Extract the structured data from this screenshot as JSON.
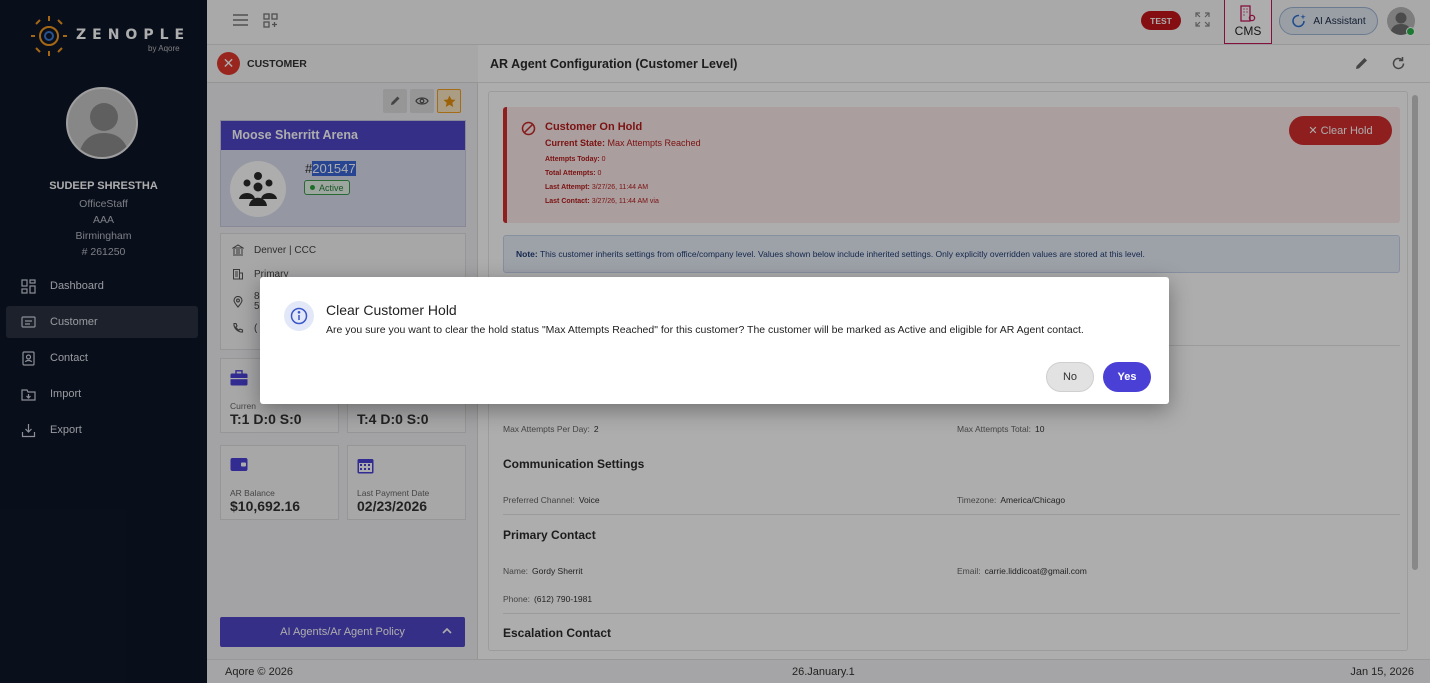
{
  "brand": {
    "name": "ZENOPLE",
    "sub": "by Aqore"
  },
  "user": {
    "name": "SUDEEP SHRESTHA",
    "role": "OfficeStaff",
    "company": "AAA",
    "location": "Birmingham",
    "id": "# 261250"
  },
  "nav": [
    {
      "label": "Dashboard",
      "icon": "dashboard-icon"
    },
    {
      "label": "Customer",
      "icon": "customer-icon",
      "active": true
    },
    {
      "label": "Contact",
      "icon": "contact-icon"
    },
    {
      "label": "Import",
      "icon": "import-icon"
    },
    {
      "label": "Export",
      "icon": "export-icon"
    }
  ],
  "topbar": {
    "test_badge": "TEST",
    "cms_label": "CMS",
    "ai_label": "AI Assistant"
  },
  "customer_panel": {
    "header": "CUSTOMER",
    "name": "Moose Sherritt Arena",
    "id_hash": "#",
    "id_value": "201547",
    "status": "Active",
    "addr_office": "Denver | CCC",
    "addr_primary": "Primary",
    "addr_line1": "8",
    "addr_line2": "5",
    "addr_phone": "(",
    "stat1_label": "Curren",
    "stat1_value": "T:1 D:0 S:0",
    "stat2_value": "T:4 D:0 S:0",
    "stat3_label": "AR Balance",
    "stat3_value": "$10,692.16",
    "stat4_label": "Last Payment Date",
    "stat4_value": "02/23/2026",
    "policy_label": "AI Agents/Ar Agent Policy"
  },
  "main": {
    "title": "AR Agent Configuration (Customer Level)",
    "hold": {
      "title": "Customer On Hold",
      "state_label": "Current State:",
      "state_value": "Max Attempts Reached",
      "attempts_today_label": "Attempts Today:",
      "attempts_today": "0",
      "total_attempts_label": "Total Attempts:",
      "total_attempts": "0",
      "last_attempt_label": "Last Attempt:",
      "last_attempt": "3/27/26, 11:44 AM",
      "last_contact_label": "Last Contact:",
      "last_contact": "3/27/26, 11:44 AM via",
      "clear_button": "✕ Clear Hold"
    },
    "note_label": "Note:",
    "note_text": "This customer inherits settings from office/company level. Values shown below include inherited settings. Only explicitly overridden values are stored at this level.",
    "max_per_day_label": "Max Attempts Per Day:",
    "max_per_day": "2",
    "max_total_label": "Max Attempts Total:",
    "max_total": "10",
    "comm_title": "Communication Settings",
    "pref_channel_label": "Preferred Channel:",
    "pref_channel": "Voice",
    "timezone_label": "Timezone:",
    "timezone": "America/Chicago",
    "primary_title": "Primary Contact",
    "name_label": "Name:",
    "name_value": "Gordy Sherrit",
    "email_label": "Email:",
    "email_value": "carrie.liddicoat@gmail.com",
    "phone_label": "Phone:",
    "phone_value": "(612) 790-1981",
    "escalation_title": "Escalation Contact"
  },
  "footer": {
    "left": "Aqore © 2026",
    "center": "26.January.1",
    "right": "Jan 15, 2026"
  },
  "dialog": {
    "title": "Clear Customer Hold",
    "message": "Are you sure you want to clear the hold status \"Max Attempts Reached\" for this customer? The customer will be marked as Active and eligible for AR Agent contact.",
    "no_label": "No",
    "yes_label": "Yes"
  },
  "colors": {
    "sidebar_bg": "#0e1628",
    "accent": "#5046c7",
    "danger": "#d32f2f",
    "yes_button": "#4b40d6"
  }
}
